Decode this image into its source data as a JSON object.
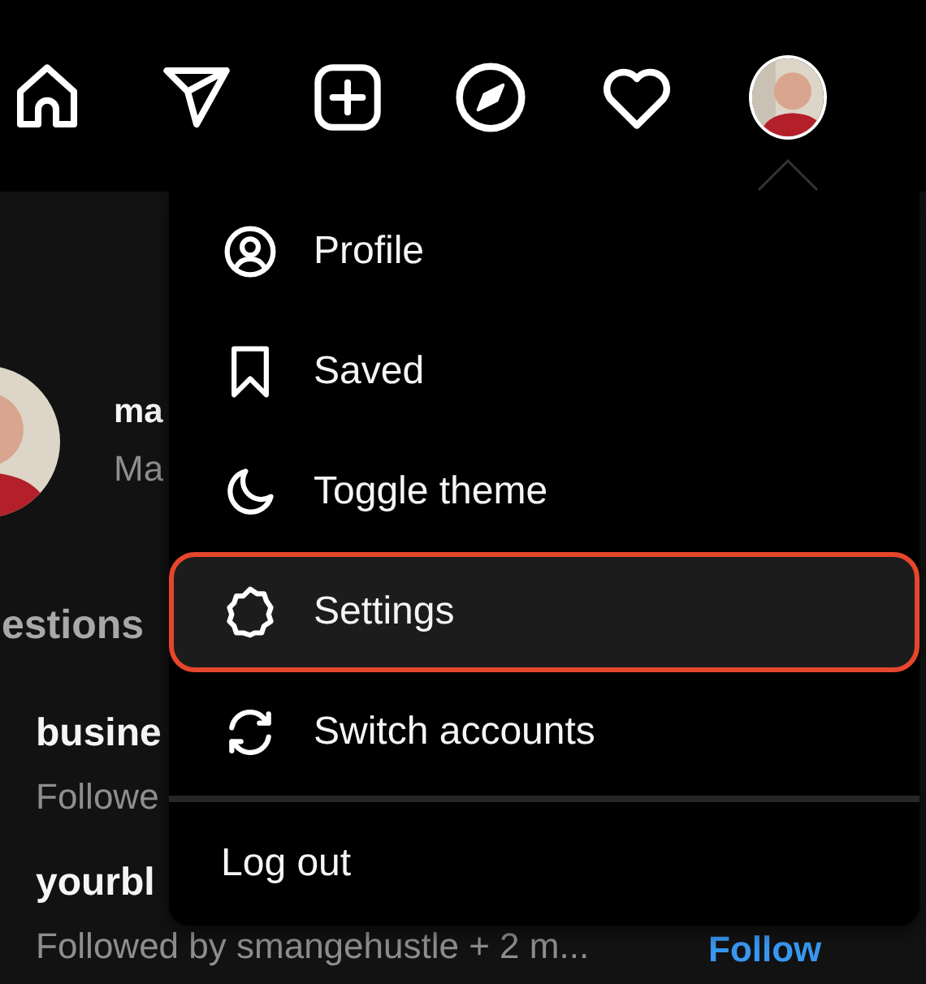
{
  "nav": {
    "items": [
      {
        "kind": "home"
      },
      {
        "kind": "send"
      },
      {
        "kind": "create"
      },
      {
        "kind": "explore"
      },
      {
        "kind": "heart"
      },
      {
        "kind": "avatar"
      }
    ]
  },
  "profile": {
    "username": "ma",
    "name": "Ma"
  },
  "suggestions": {
    "title": "estions",
    "people": [
      {
        "username": "busine",
        "note": "Followe"
      },
      {
        "username": "yourbl",
        "note": "Followed by smangehustle + 2 m...",
        "action": "Follow"
      }
    ]
  },
  "menu": {
    "items": [
      {
        "kind": "profile",
        "label": "Profile",
        "selected": false
      },
      {
        "kind": "saved",
        "label": "Saved",
        "selected": false
      },
      {
        "kind": "theme",
        "label": "Toggle theme",
        "selected": false
      },
      {
        "kind": "settings",
        "label": "Settings",
        "selected": true
      },
      {
        "kind": "switch",
        "label": "Switch accounts",
        "selected": false
      }
    ],
    "logout": "Log out"
  }
}
